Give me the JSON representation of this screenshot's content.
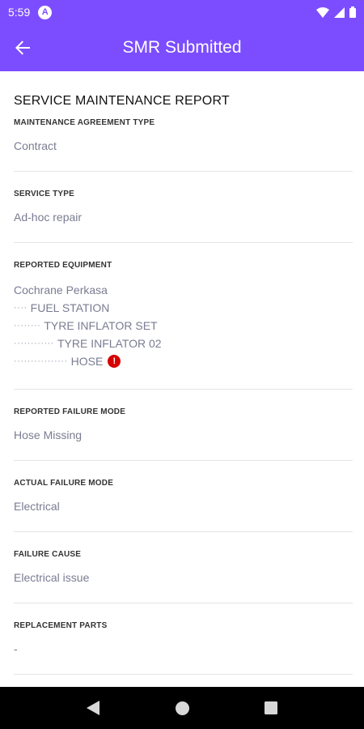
{
  "status_bar": {
    "time": "5:59",
    "app_icon_letter": "A",
    "icons": [
      "wifi-icon",
      "signal-icon",
      "battery-icon"
    ]
  },
  "app_bar": {
    "title": "SMR Submitted",
    "back_icon": "arrow-left-icon"
  },
  "report": {
    "title": "SERVICE MAINTENANCE REPORT",
    "sections": {
      "agreement_type": {
        "label": "MAINTENANCE AGREEMENT TYPE",
        "value": "Contract"
      },
      "service_type": {
        "label": "SERVICE TYPE",
        "value": "Ad-hoc repair"
      },
      "reported_equipment": {
        "label": "REPORTED EQUIPMENT",
        "items": [
          {
            "prefix": "",
            "name": "Cochrane Perkasa"
          },
          {
            "prefix": "····",
            "name": "FUEL STATION"
          },
          {
            "prefix": "········",
            "name": "TYRE INFLATOR SET"
          },
          {
            "prefix": "············",
            "name": "TYRE INFLATOR 02"
          },
          {
            "prefix": "················",
            "name": "HOSE",
            "alert": "!"
          }
        ]
      },
      "reported_failure_mode": {
        "label": "REPORTED FAILURE MODE",
        "value": "Hose Missing"
      },
      "actual_failure_mode": {
        "label": "ACTUAL FAILURE MODE",
        "value": "Electrical"
      },
      "failure_cause": {
        "label": "FAILURE CAUSE",
        "value": "Electrical issue"
      },
      "replacement_parts": {
        "label": "REPLACEMENT PARTS",
        "value": "-"
      }
    }
  },
  "colors": {
    "primary": "#7c4dff",
    "value_text": "#7a7c92",
    "alert": "#d50000"
  },
  "nav_bar": {
    "icons": [
      "back-triangle-icon",
      "home-circle-icon",
      "recents-square-icon"
    ]
  }
}
